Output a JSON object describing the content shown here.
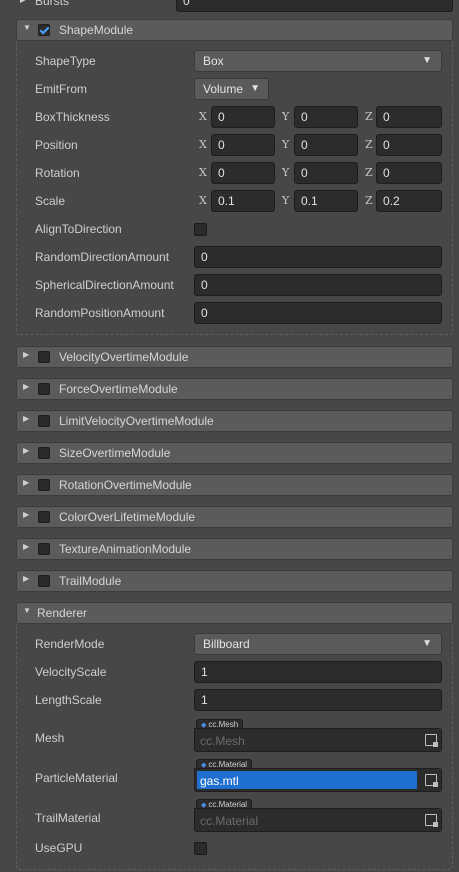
{
  "top_partial": {
    "label": "Bursts",
    "value": "0"
  },
  "shape_module": {
    "title": "ShapeModule",
    "enabled": true,
    "shape_type": {
      "label": "ShapeType",
      "value": "Box"
    },
    "emit_from": {
      "label": "EmitFrom",
      "value": "Volume"
    },
    "box_thickness": {
      "label": "BoxThickness",
      "x": "0",
      "y": "0",
      "z": "0"
    },
    "position": {
      "label": "Position",
      "x": "0",
      "y": "0",
      "z": "0"
    },
    "rotation": {
      "label": "Rotation",
      "x": "0",
      "y": "0",
      "z": "0"
    },
    "scale": {
      "label": "Scale",
      "x": "0.1",
      "y": "0.1",
      "z": "0.2"
    },
    "align_to_direction": {
      "label": "AlignToDirection",
      "checked": false
    },
    "random_direction_amount": {
      "label": "RandomDirectionAmount",
      "value": "0"
    },
    "spherical_direction_amount": {
      "label": "SphericalDirectionAmount",
      "value": "0"
    },
    "random_position_amount": {
      "label": "RandomPositionAmount",
      "value": "0"
    }
  },
  "axis_labels": {
    "x": "X",
    "y": "Y",
    "z": "Z"
  },
  "collapsed_modules": [
    "VelocityOvertimeModule",
    "ForceOvertimeModule",
    "LimitVelocityOvertimeModule",
    "SizeOvertimeModule",
    "RotationOvertimeModule",
    "ColorOverLifetimeModule",
    "TextureAnimationModule",
    "TrailModule"
  ],
  "renderer": {
    "title": "Renderer",
    "render_mode": {
      "label": "RenderMode",
      "value": "Billboard"
    },
    "velocity_scale": {
      "label": "VelocityScale",
      "value": "1"
    },
    "length_scale": {
      "label": "LengthScale",
      "value": "1"
    },
    "mesh": {
      "label": "Mesh",
      "type_tag": "cc.Mesh",
      "value": "cc.Mesh"
    },
    "particle_material": {
      "label": "ParticleMaterial",
      "type_tag": "cc.Material",
      "value": "gas.mtl"
    },
    "trail_material": {
      "label": "TrailMaterial",
      "type_tag": "cc.Material",
      "value": "cc.Material"
    },
    "use_gpu": {
      "label": "UseGPU",
      "checked": false
    }
  },
  "colors": {
    "background": "#474747",
    "header": "#5b5b5b",
    "field": "#2c2c2c",
    "selection": "#1f6fd0",
    "asset_dot": "#4b8ee8"
  },
  "icons": {
    "expanded": "triangle-down-icon",
    "collapsed": "triangle-right-icon",
    "dropdown": "caret-down-icon",
    "asset_picker": "asset-picker-icon"
  }
}
